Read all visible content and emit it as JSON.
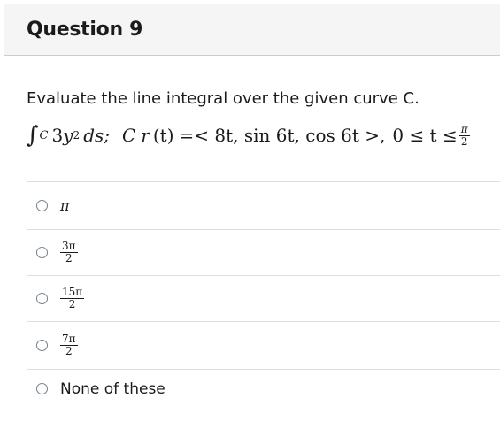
{
  "question": {
    "title": "Question 9",
    "prompt": "Evaluate the line integral over the given curve C.",
    "math": {
      "integral_sign": "∫",
      "integral_sub": "C",
      "integrand_coef": "3",
      "integrand_var": "y",
      "integrand_exp": "2",
      "differential": "ds;",
      "curve_label": "C",
      "curve_r": "r",
      "curve_t": "(t)",
      "curve_eq": "=< 8t, sin 6t, cos 6t >,",
      "range": "0 ≤ t ≤",
      "range_num": "π",
      "range_den": "2"
    }
  },
  "answers": [
    {
      "kind": "text",
      "text": "π"
    },
    {
      "kind": "frac",
      "num": "3π",
      "den": "2"
    },
    {
      "kind": "frac",
      "num": "15π",
      "den": "2"
    },
    {
      "kind": "frac",
      "num": "7π",
      "den": "2"
    },
    {
      "kind": "plain",
      "text": "None of these"
    }
  ],
  "colors": {
    "header_bg": "#f5f5f5",
    "border": "#c7cdd1",
    "divider": "#dcdfe1",
    "radio": "#73818c",
    "text": "#1b1b1b"
  }
}
